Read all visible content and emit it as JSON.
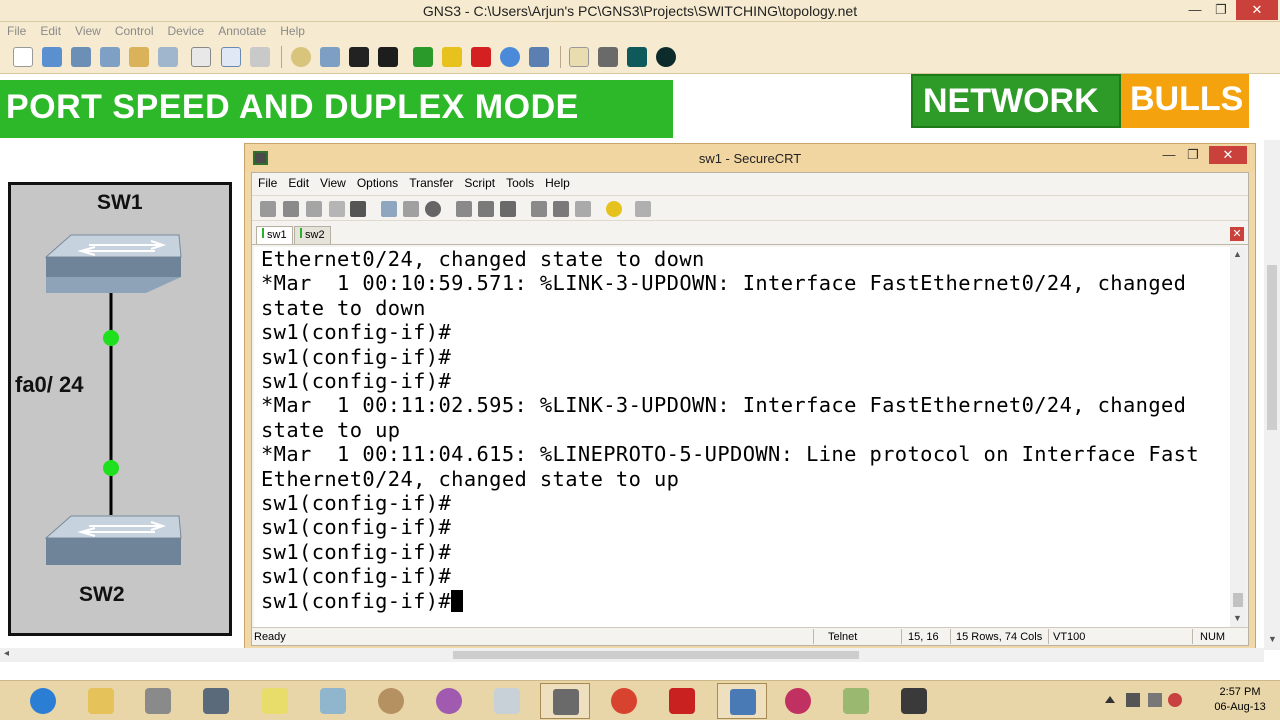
{
  "gns3": {
    "title": "GNS3 - C:\\Users\\Arjun's PC\\GNS3\\Projects\\SWITCHING\\topology.net",
    "menu": [
      "File",
      "Edit",
      "View",
      "Control",
      "Device",
      "Annotate",
      "Help"
    ],
    "window_controls": {
      "minimize": "—",
      "maximize": "❐",
      "close": "✕"
    }
  },
  "banner": {
    "title": "PORT SPEED AND DUPLEX MODE",
    "logo_left": "NETWORK",
    "logo_right": "BULLS",
    "colors": {
      "green": "#2db82a",
      "logo_green": "#2e9a28",
      "logo_orange": "#f4a30e"
    }
  },
  "topology": {
    "sw1_label": "SW1",
    "sw2_label": "SW2",
    "link_label": "fa0/ 24",
    "link_status_color": "#1ee01e"
  },
  "securecrt": {
    "title": "sw1 - SecureCRT",
    "menu": [
      "File",
      "Edit",
      "View",
      "Options",
      "Transfer",
      "Script",
      "Tools",
      "Help"
    ],
    "tabs": [
      {
        "label": "sw1",
        "active": true
      },
      {
        "label": "sw2",
        "active": false
      }
    ],
    "window_controls": {
      "minimize": "—",
      "maximize": "❐",
      "close": "✕"
    },
    "terminal_lines": [
      "Ethernet0/24, changed state to down",
      "*Mar  1 00:10:59.571: %LINK-3-UPDOWN: Interface FastEthernet0/24, changed",
      "state to down",
      "sw1(config-if)#",
      "sw1(config-if)#",
      "sw1(config-if)#",
      "*Mar  1 00:11:02.595: %LINK-3-UPDOWN: Interface FastEthernet0/24, changed",
      "state to up",
      "*Mar  1 00:11:04.615: %LINEPROTO-5-UPDOWN: Line protocol on Interface Fast",
      "Ethernet0/24, changed state to up",
      "sw1(config-if)#",
      "sw1(config-if)#",
      "sw1(config-if)#",
      "sw1(config-if)#",
      "sw1(config-if)#"
    ],
    "status": {
      "ready": "Ready",
      "protocol": "Telnet",
      "cursor_pos": "15, 16",
      "size": "15 Rows, 74 Cols",
      "emulation": "VT100",
      "num": "NUM"
    }
  },
  "taskbar": {
    "time": "2:57 PM",
    "date": "06-Aug-13"
  }
}
